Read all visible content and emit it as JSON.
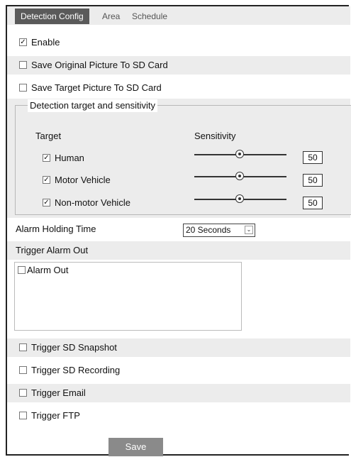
{
  "tabs": [
    {
      "label": "Detection Config",
      "active": true
    },
    {
      "label": "Area",
      "active": false
    },
    {
      "label": "Schedule",
      "active": false
    }
  ],
  "enable": {
    "label": "Enable",
    "checked": true
  },
  "save_original": {
    "label": "Save Original Picture To SD Card",
    "checked": false
  },
  "save_target": {
    "label": "Save Target Picture To SD Card",
    "checked": false
  },
  "detection": {
    "legend": "Detection target and sensitivity",
    "target_header": "Target",
    "sensitivity_header": "Sensitivity",
    "targets": [
      {
        "label": "Human",
        "checked": true,
        "sensitivity": "50"
      },
      {
        "label": "Motor Vehicle",
        "checked": true,
        "sensitivity": "50"
      },
      {
        "label": "Non-motor Vehicle",
        "checked": true,
        "sensitivity": "50"
      }
    ]
  },
  "alarm_holding": {
    "label": "Alarm Holding Time",
    "value": "20 Seconds"
  },
  "trigger_alarm_out": {
    "label": "Trigger Alarm Out",
    "items": [
      {
        "label": "Alarm Out",
        "checked": false
      }
    ]
  },
  "triggers": [
    {
      "label": "Trigger SD Snapshot",
      "checked": false
    },
    {
      "label": "Trigger SD Recording",
      "checked": false
    },
    {
      "label": "Trigger Email",
      "checked": false
    },
    {
      "label": "Trigger FTP",
      "checked": false
    }
  ],
  "save_button": "Save",
  "glyphs": {
    "check": "✓",
    "dropdown": "⌄"
  },
  "colors": {
    "panel_gray": "#ececec",
    "tab_active": "#5a5a5a",
    "save_button": "#8a8a8a"
  }
}
